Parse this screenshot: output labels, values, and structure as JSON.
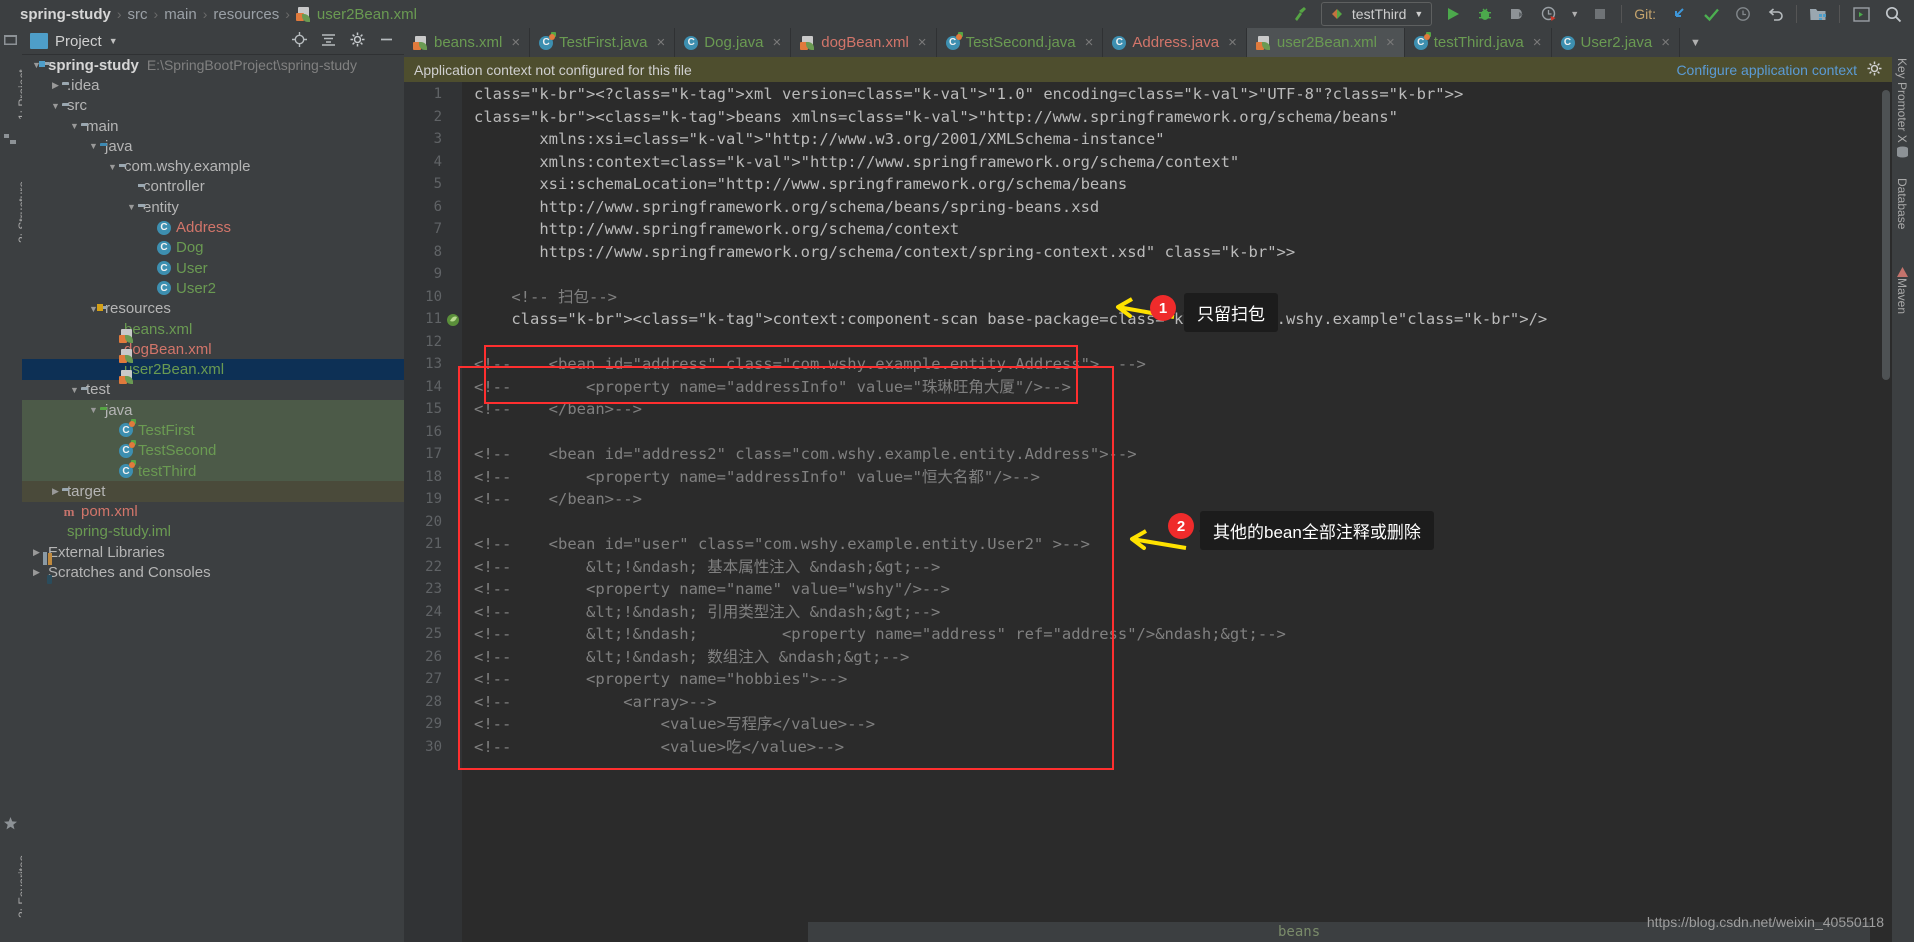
{
  "window": {
    "title": "spring-study – user2Bean.xml"
  },
  "breadcrumb": {
    "items": [
      "spring-study",
      "src",
      "main",
      "resources",
      "user2Bean.xml"
    ],
    "file_icon": "xml-spring-icon"
  },
  "toolbar": {
    "build_icon": "hammer-icon",
    "run_config": "testThird",
    "run_config_chevron": "chevron-down-icon",
    "run_icon": "run-icon",
    "debug_icon": "debug-bug-icon",
    "coverage_icon": "run-with-coverage-icon",
    "profiler_icon": "profiler-icon",
    "profiler_chevron": "chevron-down-icon",
    "stop_icon": "stop-icon",
    "git_label": "Git:",
    "git_update_icon": "update-project-icon",
    "git_commit_icon": "commit-check-icon",
    "git_history_icon": "history-clock-icon",
    "git_rollback_icon": "rollback-icon",
    "open_project_icon": "open-project-icon",
    "terminal_icon": "terminal-icon",
    "search_icon": "search-everywhere-icon"
  },
  "left_strip": {
    "items": [
      "1: Project",
      "2: Structure",
      "2: Favorites"
    ]
  },
  "right_strip": {
    "items": [
      "Key Promoter X",
      "Database",
      "Maven"
    ]
  },
  "project_panel": {
    "title": "Project",
    "chevron": "chevron-down-icon",
    "icons": [
      "locate-icon",
      "collapse-all-icon",
      "settings-gear-icon",
      "hide-icon"
    ],
    "tree": [
      {
        "depth": 0,
        "arrow": "▼",
        "icon": "module-folder-icon",
        "label": "spring-study",
        "path": "E:\\SpringBootProject\\spring-study",
        "style": "bold"
      },
      {
        "depth": 1,
        "arrow": "▶",
        "icon": "folder-icon",
        "label": ".idea",
        "path": "",
        "style": ""
      },
      {
        "depth": 1,
        "arrow": "▼",
        "icon": "folder-icon",
        "label": "src",
        "path": "",
        "style": ""
      },
      {
        "depth": 2,
        "arrow": "▼",
        "icon": "folder-icon",
        "label": "main",
        "path": "",
        "style": ""
      },
      {
        "depth": 3,
        "arrow": "▼",
        "icon": "source-folder-icon",
        "label": "java",
        "path": "",
        "style": ""
      },
      {
        "depth": 4,
        "arrow": "▼",
        "icon": "package-icon",
        "label": "com.wshy.example",
        "path": "",
        "style": ""
      },
      {
        "depth": 5,
        "arrow": "",
        "icon": "package-icon",
        "label": "controller",
        "path": "",
        "style": ""
      },
      {
        "depth": 5,
        "arrow": "▼",
        "icon": "package-icon",
        "label": "entity",
        "path": "",
        "style": ""
      },
      {
        "depth": 6,
        "arrow": "",
        "icon": "class-icon",
        "label": "Address",
        "path": "",
        "style": "salmon"
      },
      {
        "depth": 6,
        "arrow": "",
        "icon": "class-icon",
        "label": "Dog",
        "path": "",
        "style": "green"
      },
      {
        "depth": 6,
        "arrow": "",
        "icon": "class-icon",
        "label": "User",
        "path": "",
        "style": "green"
      },
      {
        "depth": 6,
        "arrow": "",
        "icon": "class-icon",
        "label": "User2",
        "path": "",
        "style": "green"
      },
      {
        "depth": 3,
        "arrow": "▼",
        "icon": "resource-folder-icon",
        "label": "resources",
        "path": "",
        "style": ""
      },
      {
        "depth": 4,
        "arrow": "",
        "icon": "xml-spring-icon",
        "label": "beans.xml",
        "path": "",
        "style": "green"
      },
      {
        "depth": 4,
        "arrow": "",
        "icon": "xml-spring-icon",
        "label": "dogBean.xml",
        "path": "",
        "style": "salmon"
      },
      {
        "depth": 4,
        "arrow": "",
        "icon": "xml-spring-icon",
        "label": "user2Bean.xml",
        "path": "",
        "style": "green",
        "selected": true
      },
      {
        "depth": 2,
        "arrow": "▼",
        "icon": "folder-icon",
        "label": "test",
        "path": "",
        "style": ""
      },
      {
        "depth": 3,
        "arrow": "▼",
        "icon": "test-source-folder-icon",
        "label": "java",
        "path": "",
        "style": "",
        "testsrc": true
      },
      {
        "depth": 4,
        "arrow": "",
        "icon": "test-class-icon",
        "label": "TestFirst",
        "path": "",
        "style": "green",
        "testsrc": true
      },
      {
        "depth": 4,
        "arrow": "",
        "icon": "test-class-icon",
        "label": "TestSecond",
        "path": "",
        "style": "green",
        "testsrc": true
      },
      {
        "depth": 4,
        "arrow": "",
        "icon": "test-class-icon",
        "label": "testThird",
        "path": "",
        "style": "green",
        "testsrc": true
      },
      {
        "depth": 1,
        "arrow": "▶",
        "icon": "folder-icon",
        "label": "target",
        "path": "",
        "style": "",
        "target": true
      },
      {
        "depth": 1,
        "arrow": "",
        "icon": "maven-pom-icon",
        "label": "pom.xml",
        "path": "",
        "style": "salmon"
      },
      {
        "depth": 1,
        "arrow": "",
        "icon": "iml-icon",
        "label": "spring-study.iml",
        "path": "",
        "style": "green"
      },
      {
        "depth": 0,
        "arrow": "▶",
        "icon": "library-icon",
        "label": "External Libraries",
        "path": "",
        "style": ""
      },
      {
        "depth": 0,
        "arrow": "▶",
        "icon": "scratches-icon",
        "label": "Scratches and Consoles",
        "path": "",
        "style": ""
      }
    ]
  },
  "editor_tabs": {
    "items": [
      {
        "label": "beans.xml",
        "icon": "xml-spring-icon",
        "color": "green",
        "active": false
      },
      {
        "label": "TestFirst.java",
        "icon": "test-class-icon",
        "color": "green",
        "active": false
      },
      {
        "label": "Dog.java",
        "icon": "class-icon",
        "color": "green",
        "active": false
      },
      {
        "label": "dogBean.xml",
        "icon": "xml-spring-icon",
        "color": "salmon",
        "active": false
      },
      {
        "label": "TestSecond.java",
        "icon": "test-class-icon",
        "color": "green",
        "active": false
      },
      {
        "label": "Address.java",
        "icon": "class-icon",
        "color": "salmon",
        "active": false
      },
      {
        "label": "user2Bean.xml",
        "icon": "xml-spring-icon",
        "color": "green",
        "active": true
      },
      {
        "label": "testThird.java",
        "icon": "test-class-icon",
        "color": "green",
        "active": false
      },
      {
        "label": "User2.java",
        "icon": "class-icon",
        "color": "green",
        "active": false
      }
    ],
    "close_glyph": "×",
    "overflow_chevron": "chevron-down-icon"
  },
  "notification": {
    "message": "Application context not configured for this file",
    "action": "Configure application context",
    "gear_icon": "settings-gear-icon"
  },
  "editor": {
    "filename": "user2Bean.xml",
    "breadcrumb_bottom": "beans",
    "line_numbers": [
      1,
      2,
      3,
      4,
      5,
      6,
      7,
      8,
      9,
      10,
      11,
      12,
      13,
      14,
      15,
      16,
      17,
      18,
      19,
      20,
      21,
      22,
      23,
      24,
      25,
      26,
      27,
      28,
      29,
      30
    ],
    "lines": [
      "<?xml version=\"1.0\" encoding=\"UTF-8\"?>",
      "<beans xmlns=\"http://www.springframework.org/schema/beans\"",
      "       xmlns:xsi=\"http://www.w3.org/2001/XMLSchema-instance\"",
      "       xmlns:context=\"http://www.springframework.org/schema/context\"",
      "       xsi:schemaLocation=\"http://www.springframework.org/schema/beans",
      "       http://www.springframework.org/schema/beans/spring-beans.xsd",
      "       http://www.springframework.org/schema/context",
      "       https://www.springframework.org/schema/context/spring-context.xsd\" >",
      "",
      "    <!-- 扫包-->",
      "    <context:component-scan base-package=\"com.wshy.example\"/>",
      "",
      "<!--    <bean id=\"address\" class=\"com.wshy.example.entity.Address\">  -->",
      "<!--        <property name=\"addressInfo\" value=\"珠琳旺角大厦\"/>-->",
      "<!--    </bean>-->",
      "",
      "<!--    <bean id=\"address2\" class=\"com.wshy.example.entity.Address\">-->",
      "<!--        <property name=\"addressInfo\" value=\"恒大名都\"/>-->",
      "<!--    </bean>-->",
      "",
      "<!--    <bean id=\"user\" class=\"com.wshy.example.entity.User2\" >-->",
      "<!--        &lt;!&ndash; 基本属性注入 &ndash;&gt;-->",
      "<!--        <property name=\"name\" value=\"wshy\"/>-->",
      "<!--        &lt;!&ndash; 引用类型注入 &ndash;&gt;-->",
      "<!--        &lt;!&ndash;         <property name=\"address\" ref=\"address\"/>&ndash;&gt;-->",
      "<!--        &lt;!&ndash; 数组注入 &ndash;&gt;-->",
      "<!--        <property name=\"hobbies\">-->",
      "<!--            <array>-->",
      "<!--                <value>写程序</value>-->",
      "<!--                <value>吃</value>-->"
    ],
    "gutter_marker_line": 11,
    "gutter_marker_icon": "spring-bean-gutter-icon"
  },
  "annotations": [
    {
      "number": "1",
      "text": "只留扫包"
    },
    {
      "number": "2",
      "text": "其他的bean全部注释或删除"
    }
  ],
  "watermark": "https://blog.csdn.net/weixin_40550118",
  "colors": {
    "accent_red": "#ff2f2f",
    "arrow_yellow": "#ffe200",
    "bubble_bg": "#1c1c1c",
    "editor_bg": "#2b2b2b",
    "panel_bg": "#3c3f41",
    "selection": "#0d3055",
    "notification_bg": "#4e4e2e",
    "string_green": "#6a8759",
    "tag_yellow": "#e8bf6a",
    "comment_gray": "#808080"
  }
}
